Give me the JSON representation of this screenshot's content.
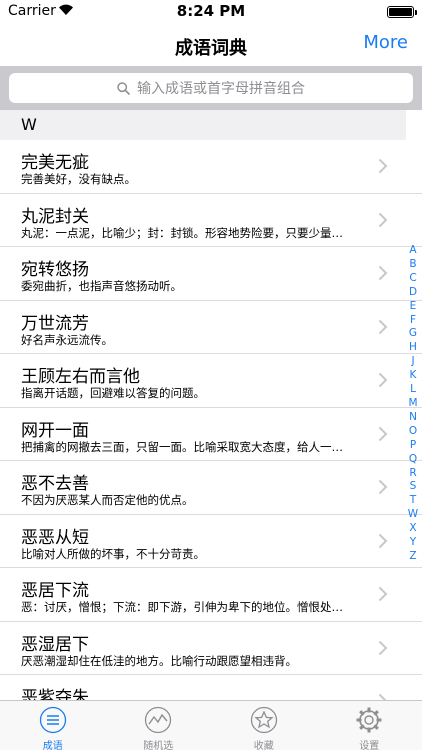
{
  "status": {
    "carrier": "Carrier",
    "time": "8:24 PM",
    "battery_level": 1.0
  },
  "nav": {
    "title": "成语词典",
    "more_label": "More",
    "accent": "#1a7cf2"
  },
  "search": {
    "placeholder": "输入成语或首字母拼音组合"
  },
  "section": {
    "letter": "W"
  },
  "items": [
    {
      "title": "完美无疵",
      "desc": "完善美好，没有缺点。"
    },
    {
      "title": "丸泥封关",
      "desc": "丸泥：一点泥，比喻少；封：封锁。形容地势险要，只要少量…"
    },
    {
      "title": "宛转悠扬",
      "desc": "委宛曲折，也指声音悠扬动听。"
    },
    {
      "title": "万世流芳",
      "desc": "好名声永远流传。"
    },
    {
      "title": "王顾左右而言他",
      "desc": "指离开话题，回避难以答复的问题。"
    },
    {
      "title": "网开一面",
      "desc": "把捕禽的网撤去三面，只留一面。比喻采取宽大态度，给人一…"
    },
    {
      "title": "恶不去善",
      "desc": "不因为厌恶某人而否定他的优点。"
    },
    {
      "title": "恶恶从短",
      "desc": "比喻对人所做的坏事，不十分苛责。"
    },
    {
      "title": "恶居下流",
      "desc": "恶：讨厌，憎恨；下流：即下游，引伸为卑下的地位。憎恨处…"
    },
    {
      "title": "恶湿居下",
      "desc": "厌恶潮湿却住在低洼的地方。比喻行动跟愿望相违背。"
    },
    {
      "title": "恶紫夺朱",
      "desc": ""
    }
  ],
  "index_letters": [
    "A",
    "B",
    "C",
    "D",
    "E",
    "F",
    "G",
    "H",
    "J",
    "K",
    "L",
    "M",
    "N",
    "O",
    "P",
    "Q",
    "R",
    "S",
    "T",
    "W",
    "X",
    "Y",
    "Z"
  ],
  "tabs": [
    {
      "label": "成语",
      "icon": "list-icon",
      "active": true
    },
    {
      "label": "随机选",
      "icon": "random-icon",
      "active": false
    },
    {
      "label": "收藏",
      "icon": "star-icon",
      "active": false
    },
    {
      "label": "设置",
      "icon": "gear-icon",
      "active": false
    }
  ]
}
